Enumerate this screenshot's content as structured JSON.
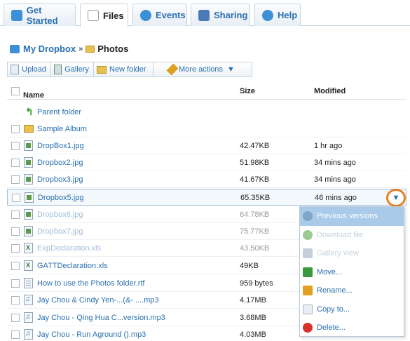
{
  "tabs": [
    {
      "label": "Get Started",
      "icon": "dropbox-icon",
      "color": "#3d8fd8"
    },
    {
      "label": "Files",
      "icon": "files-icon",
      "color": "#6b7b8c"
    },
    {
      "label": "Events",
      "icon": "events-icon",
      "color": "#3d8fd8"
    },
    {
      "label": "Sharing",
      "icon": "sharing-icon",
      "color": "#4a7ab8"
    },
    {
      "label": "Help",
      "icon": "help-icon",
      "color": "#3d8fd8"
    }
  ],
  "active_tab": "Files",
  "breadcrumb": {
    "root": "My Dropbox",
    "separator": "»",
    "current": "Photos"
  },
  "toolbar": {
    "upload": "Upload",
    "gallery": "Gallery",
    "new_folder": "New folder",
    "more_actions": "More actions"
  },
  "table": {
    "headers": {
      "name": "Name",
      "size": "Size",
      "modified": "Modified"
    },
    "parent": "Parent folder",
    "rows": [
      {
        "name": "Sample Album",
        "size": "",
        "modified": "",
        "type": "folder"
      },
      {
        "name": "DropBox1.jpg",
        "size": "42.47KB",
        "modified": "1 hr ago",
        "type": "image"
      },
      {
        "name": "Dropbox2.jpg",
        "size": "51.98KB",
        "modified": "34 mins ago",
        "type": "image"
      },
      {
        "name": "Dropbox3.jpg",
        "size": "41.67KB",
        "modified": "34 mins ago",
        "type": "image"
      },
      {
        "name": "Dropbox5.jpg",
        "size": "65.35KB",
        "modified": "46 mins ago",
        "type": "image"
      },
      {
        "name": "Dropbox6.jpg",
        "size": "64.78KB",
        "modified": "",
        "type": "image"
      },
      {
        "name": "Dropbox7.jpg",
        "size": "75.77KB",
        "modified": "",
        "type": "image"
      },
      {
        "name": "ExpDeclaration.xls",
        "size": "43.50KB",
        "modified": "",
        "type": "xls"
      },
      {
        "name": "GATTDeclaration.xls",
        "size": "49KB",
        "modified": "",
        "type": "xls"
      },
      {
        "name": "How to use the Photos folder.rtf",
        "size": "959 bytes",
        "modified": "",
        "type": "doc"
      },
      {
        "name": "Jay Chou & Cindy Yen-...(&- ....mp3",
        "size": "4.17MB",
        "modified": "",
        "type": "mp3"
      },
      {
        "name": "Jay Chou - Qing Hua C...version.mp3",
        "size": "3.68MB",
        "modified": "",
        "type": "mp3"
      },
      {
        "name": "Jay Chou - Run Aground ().mp3",
        "size": "4.03MB",
        "modified": "",
        "type": "mp3"
      }
    ]
  },
  "context_menu": {
    "items": [
      {
        "label": "Previous versions",
        "icon": "history-icon",
        "color": "#7fa6c9"
      },
      {
        "label": "Download file",
        "icon": "download-icon",
        "color": "#5aa84a"
      },
      {
        "label": "Gallery view",
        "icon": "gallery-icon",
        "color": "#9db3c7"
      },
      {
        "label": "Move...",
        "icon": "move-icon",
        "color": "#3b9a3b"
      },
      {
        "label": "Rename...",
        "icon": "rename-icon",
        "color": "#e0a020"
      },
      {
        "label": "Copy to...",
        "icon": "copy-icon",
        "color": "#a9b4bf"
      },
      {
        "label": "Delete...",
        "icon": "delete-icon",
        "color": "#d9322b"
      }
    ]
  }
}
